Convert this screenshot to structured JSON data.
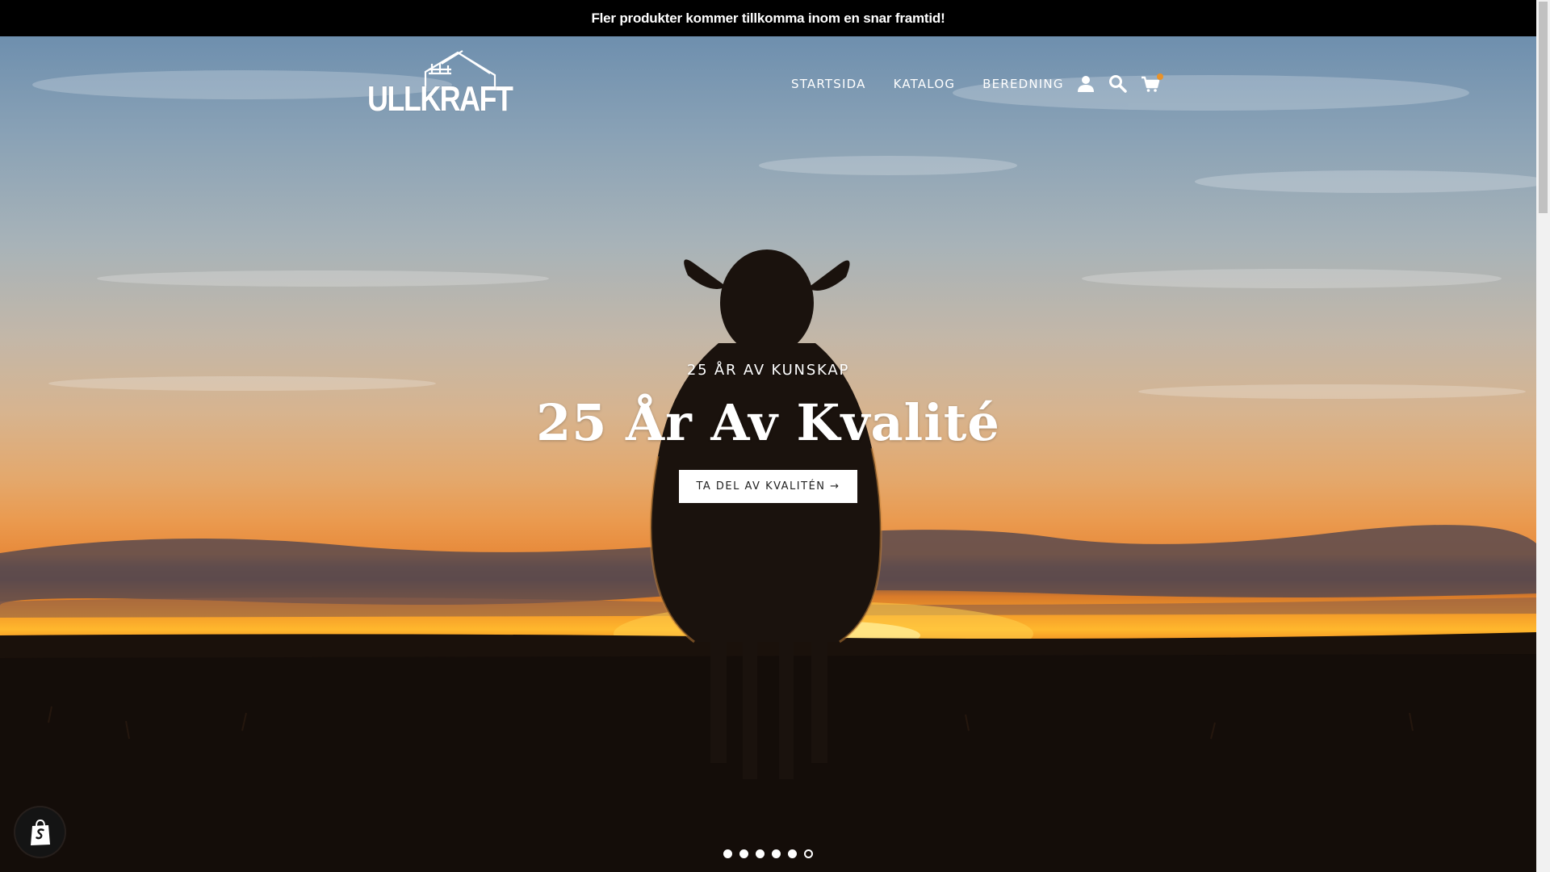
{
  "announcement": {
    "text": "Fler produkter kommer tillkomma inom en snar framtid!"
  },
  "logo": {
    "text": "ULLKRAFT"
  },
  "nav": {
    "items": [
      {
        "label": "STARTSIDA"
      },
      {
        "label": "KATALOG"
      },
      {
        "label": "BEREDNING"
      }
    ],
    "icons": [
      "account-icon",
      "search-icon",
      "cart-icon"
    ],
    "cart_dot_color": "#e8922a"
  },
  "hero": {
    "subheading": "25 ÅR AV KUNSKAP",
    "heading": "25 År Av Kvalité",
    "cta_label": "TA DEL AV KVALITÉN →",
    "image": "sheep-silhouette-at-sunset"
  },
  "slideshow": {
    "total_slides": 6,
    "active_index": 5
  },
  "shopify_badge": {
    "icon": "shopify-bag-icon"
  },
  "colors": {
    "announcement_bg": "#000000",
    "text": "#ffffff",
    "cta_bg": "#ffffff",
    "cta_text": "#222222"
  }
}
